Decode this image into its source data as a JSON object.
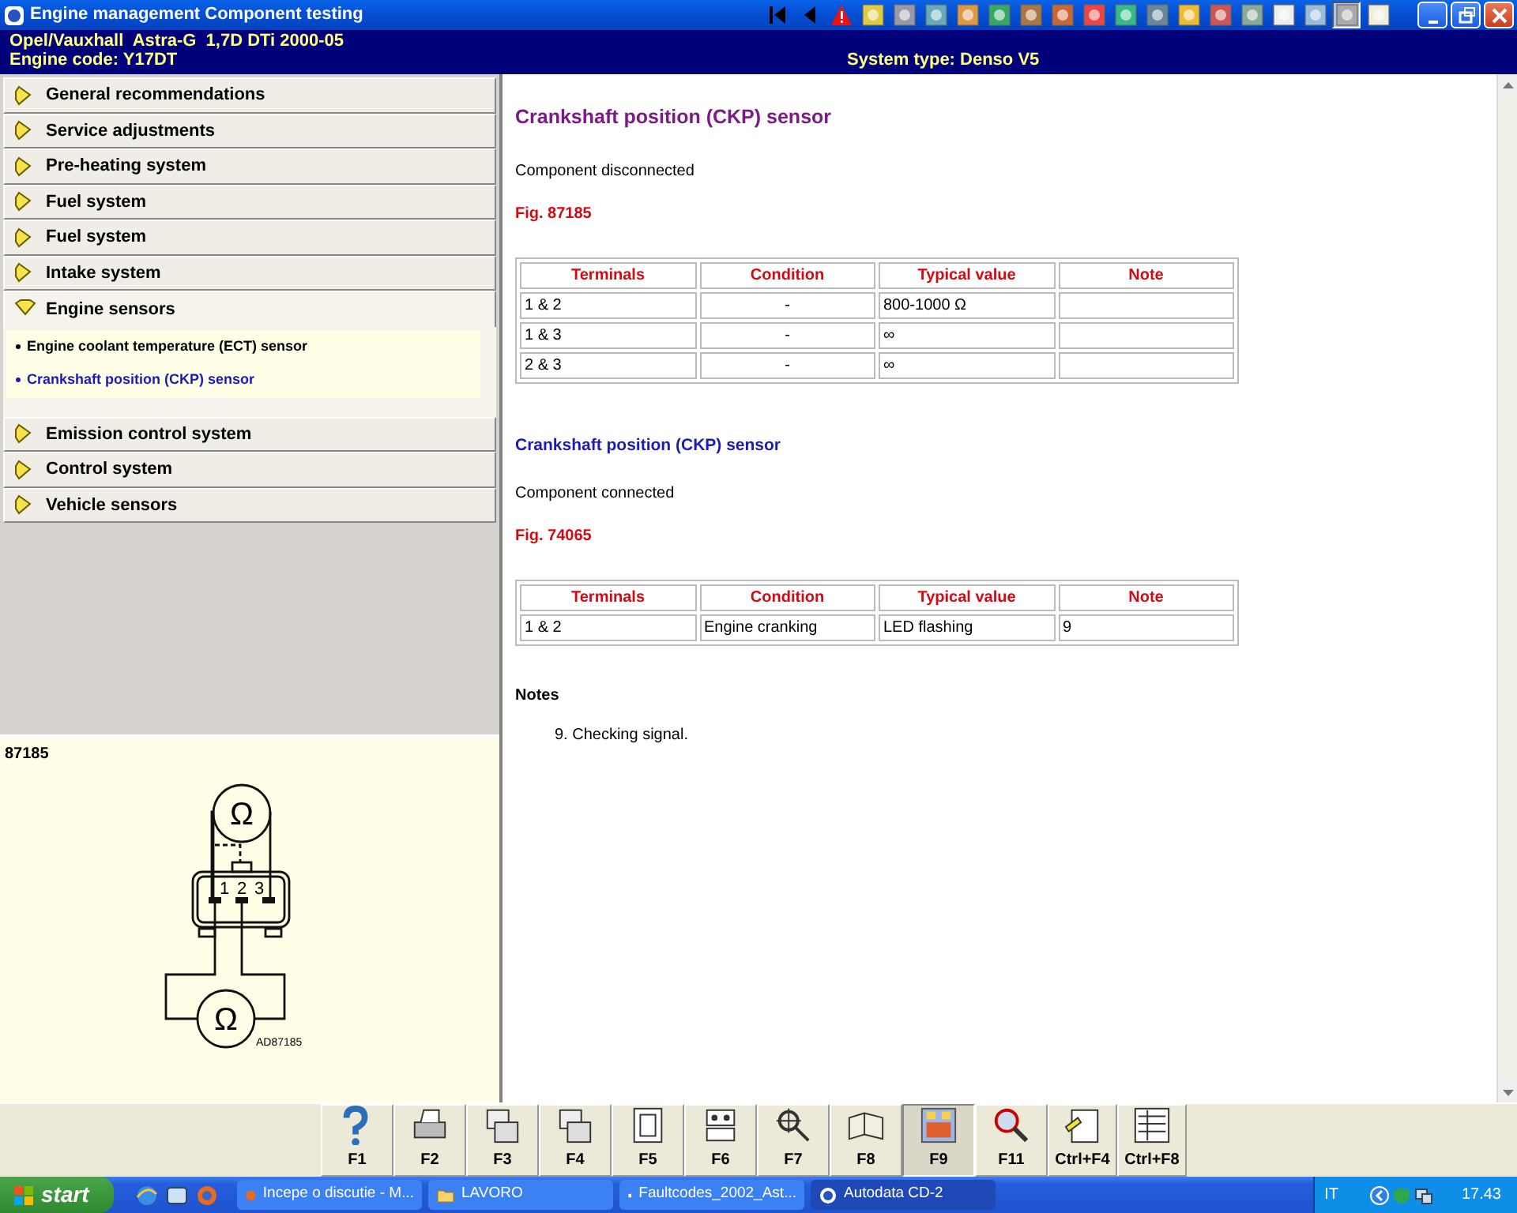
{
  "window": {
    "title": "Engine management Component testing"
  },
  "toolbar": [
    {
      "selected": false
    },
    {
      "selected": false
    },
    {
      "selected": false
    },
    {
      "selected": false
    },
    {
      "selected": false
    },
    {
      "selected": false
    },
    {
      "selected": false
    },
    {
      "selected": false
    },
    {
      "selected": false
    },
    {
      "selected": false
    },
    {
      "selected": false
    },
    {
      "selected": false
    },
    {
      "selected": false
    },
    {
      "selected": false
    },
    {
      "selected": false
    },
    {
      "selected": false
    },
    {
      "selected": false
    },
    {
      "selected": false
    },
    {
      "selected": true
    },
    {
      "selected": false
    }
  ],
  "vehicle": {
    "model": "Opel/Vauxhall  Astra-G  1,7D DTi 2000-05",
    "engine_code": "Engine code: Y17DT",
    "system_type": "System type: Denso V5"
  },
  "sidebar": {
    "items": [
      {
        "label": "General recommendations",
        "expanded": false
      },
      {
        "label": "Service adjustments",
        "expanded": false
      },
      {
        "label": "Pre-heating system",
        "expanded": false
      },
      {
        "label": "Fuel system",
        "expanded": false
      },
      {
        "label": "Fuel system",
        "expanded": false
      },
      {
        "label": "Intake system",
        "expanded": false
      },
      {
        "label": "Engine sensors",
        "expanded": true,
        "children": [
          {
            "label": "Engine coolant temperature (ECT) sensor",
            "selected": false
          },
          {
            "label": "Crankshaft position (CKP) sensor",
            "selected": true
          }
        ]
      },
      {
        "label": "Emission control system",
        "expanded": false
      },
      {
        "label": "Control system",
        "expanded": false
      },
      {
        "label": "Vehicle sensors",
        "expanded": false
      }
    ]
  },
  "figure": {
    "label": "87185",
    "pins": [
      "1",
      "2",
      "3"
    ],
    "meters": [
      "Ω",
      "Ω"
    ],
    "code": "AD87185"
  },
  "content": {
    "heading": "Crankshaft position (CKP) sensor",
    "sections": [
      {
        "status": "Component disconnected",
        "figure": "Fig. 87185",
        "table": {
          "columns": [
            "Terminals",
            "Condition",
            "Typical value",
            "Note"
          ],
          "rows": [
            [
              "1 & 2",
              "-",
              "800-1000 Ω",
              ""
            ],
            [
              "1 & 3",
              "-",
              "∞",
              ""
            ],
            [
              "2 & 3",
              "-",
              "∞",
              ""
            ]
          ]
        }
      },
      {
        "subheading": "Crankshaft position (CKP) sensor",
        "status": "Component connected",
        "figure": "Fig. 74065",
        "table": {
          "columns": [
            "Terminals",
            "Condition",
            "Typical value",
            "Note"
          ],
          "rows": [
            [
              "1 & 2",
              "Engine cranking",
              "LED flashing",
              "9"
            ]
          ]
        }
      }
    ],
    "notes": {
      "title": "Notes",
      "items": [
        "9. Checking signal."
      ]
    }
  },
  "function_keys": [
    {
      "label": "F1",
      "selected": false
    },
    {
      "label": "F2",
      "selected": false
    },
    {
      "label": "F3",
      "selected": false
    },
    {
      "label": "F4",
      "selected": false
    },
    {
      "label": "F5",
      "selected": false
    },
    {
      "label": "F6",
      "selected": false
    },
    {
      "label": "F7",
      "selected": false
    },
    {
      "label": "F8",
      "selected": false
    },
    {
      "label": "F9",
      "selected": true
    },
    {
      "label": "F11",
      "selected": false
    },
    {
      "label": "Ctrl+F4",
      "selected": false
    },
    {
      "label": "Ctrl+F8",
      "selected": false
    }
  ],
  "taskbar": {
    "start": "start",
    "tasks": [
      {
        "label": "Incepe o discutie - M...",
        "selected": false
      },
      {
        "label": "LAVORO",
        "selected": false
      },
      {
        "label": "Faultcodes_2002_Ast...",
        "selected": false
      },
      {
        "label": "Autodata CD-2",
        "selected": true
      }
    ],
    "language": "IT",
    "clock": "17.43"
  }
}
